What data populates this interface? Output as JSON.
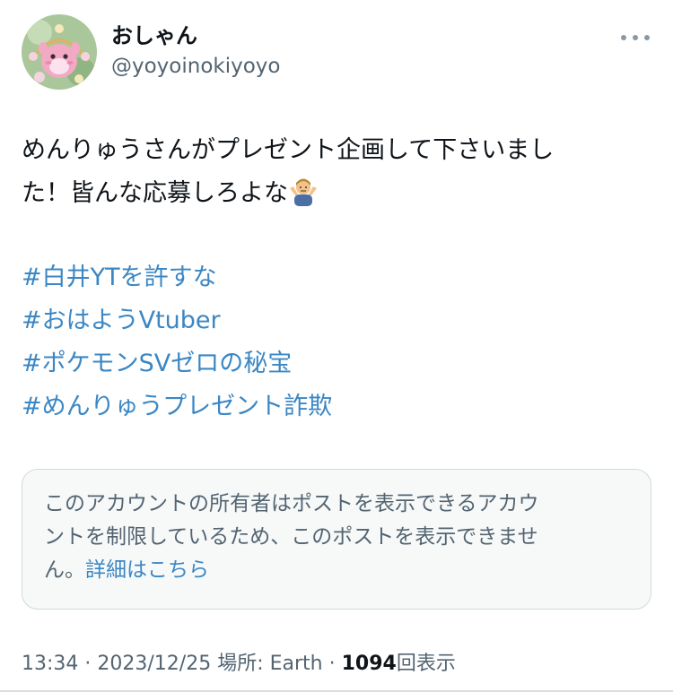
{
  "author": {
    "display_name": "おしゃん",
    "handle": "@yoyoinokiyoyo",
    "avatar_icon": "pink-character-avatar"
  },
  "menu": {
    "icon": "more-dots-icon"
  },
  "tweet": {
    "line1": "めんりゅうさんがプレゼント企画して下さいまし",
    "line2": "た！皆んな応募しろよな",
    "emoji": "person-shrugging-emoji",
    "hashtags": [
      "#白井YTを許すな",
      "#おはようVtuber",
      "#ポケモンSVゼロの秘宝",
      "#めんりゅうプレゼント詐欺"
    ]
  },
  "notice": {
    "line1": "このアカウントの所有者はポストを表示できるアカウ",
    "line2": "ントを制限しているため、このポストを表示できませ",
    "line3_prefix": "ん。",
    "link": "詳細はこちら"
  },
  "meta": {
    "time": "13:34",
    "sep1": " · ",
    "date": "2023/12/25",
    "place_label": "場所: Earth",
    "sep2": " · ",
    "view_count": "1094",
    "view_label": "回表示"
  },
  "colors": {
    "link": "#3b87c4",
    "secondary_text": "#536471",
    "notice_border": "#cfd9de",
    "notice_background": "#f7f9f9"
  }
}
